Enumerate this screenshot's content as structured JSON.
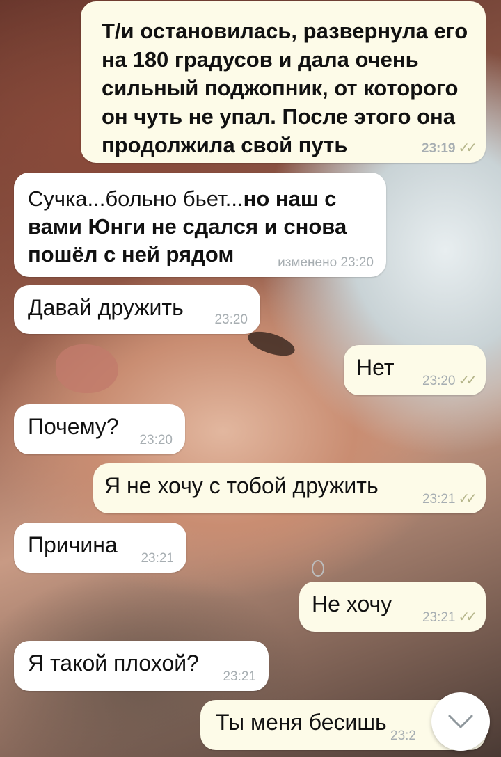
{
  "messages": [
    {
      "direction": "out",
      "text": "Т/и остановилась, развернула его на 180 градусов и дала очень сильный поджопник, от которого он чуть не упал. После этого она продолжила свой путь",
      "time": "23:19",
      "ticks": "✓✓"
    },
    {
      "direction": "in",
      "text": "Сучка...больно бьет...",
      "bold_text": "но наш с вами Юнги не сдался и снова пошёл с ней рядом",
      "edited": "изменено",
      "time": "23:20"
    },
    {
      "direction": "in",
      "text": "Давай дружить",
      "time": "23:20"
    },
    {
      "direction": "out",
      "text": "Нет",
      "time": "23:20",
      "ticks": "✓✓"
    },
    {
      "direction": "in",
      "text": "Почему?",
      "time": "23:20"
    },
    {
      "direction": "out",
      "text": "Я не хочу с тобой дружить",
      "time": "23:21",
      "ticks": "✓✓"
    },
    {
      "direction": "in",
      "text": "Причина",
      "time": "23:21"
    },
    {
      "direction": "out",
      "text": "Не хочу",
      "time": "23:21",
      "ticks": "✓✓"
    },
    {
      "direction": "in",
      "text": "Я такой плохой?",
      "time": "23:21"
    },
    {
      "direction": "out",
      "text": "Ты меня бесишь",
      "time": "23:2",
      "ticks": "✓✓"
    }
  ],
  "scroll_button": {
    "icon": "chevron-down-icon"
  },
  "colors": {
    "outgoing": "#fdfbe8",
    "incoming": "#ffffff",
    "meta": "#a7aeb2"
  }
}
